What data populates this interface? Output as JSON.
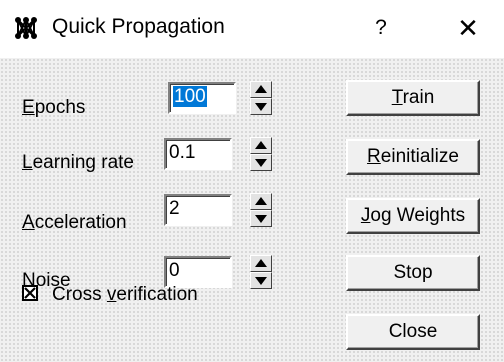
{
  "window": {
    "title": "Quick Propagation",
    "help_label": "?",
    "close_label": "✕",
    "icon": "network-icon"
  },
  "fields": [
    {
      "label_first": "E",
      "label_rest": "pochs",
      "value": "100",
      "selected": true
    },
    {
      "label_first": "L",
      "label_rest": "earning rate",
      "value": "0.1",
      "selected": false
    },
    {
      "label_first": "A",
      "label_rest": "cceleration",
      "value": "2",
      "selected": false
    },
    {
      "label_first": "N",
      "label_rest": "oise",
      "value": "0",
      "selected": false
    }
  ],
  "buttons": {
    "train": {
      "mn": "T",
      "rest": "rain"
    },
    "reinitialize": {
      "mn": "R",
      "rest": "einitialize"
    },
    "jog": {
      "mn": "J",
      "rest": "og Weights"
    },
    "stop": {
      "label": "Stop"
    },
    "close": {
      "label": "Close"
    }
  },
  "cross_verification": {
    "label_pre": "Cross ",
    "label_mn": "v",
    "label_rest": "erification",
    "checked": true,
    "check_glyph": "✕"
  }
}
